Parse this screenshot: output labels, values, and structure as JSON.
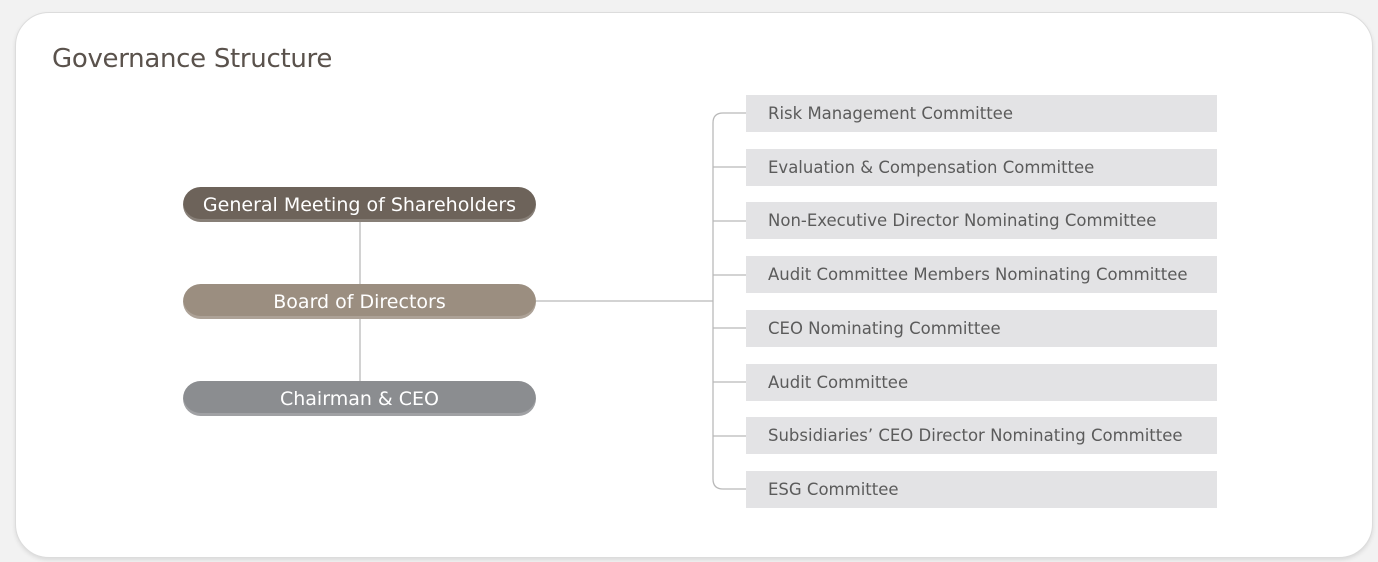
{
  "title": "Governance Structure",
  "hierarchy": {
    "general_meeting": "General Meeting of Shareholders",
    "board": "Board of Directors",
    "chairman_ceo": "Chairman & CEO"
  },
  "committees": [
    "Risk Management Committee",
    "Evaluation & Compensation Committee",
    "Non-Executive Director Nominating Committee",
    "Audit Committee Members Nominating Committee",
    "CEO Nominating Committee",
    "Audit Committee",
    "Subsidiaries’ CEO Director Nominating Committee",
    "ESG Committee"
  ],
  "colors": {
    "general_meeting": "#6d635a",
    "board": "#9b8e80",
    "chairman_ceo": "#8b8d90",
    "committee_bg": "#e3e3e5",
    "connector": "#b9b9b9"
  }
}
